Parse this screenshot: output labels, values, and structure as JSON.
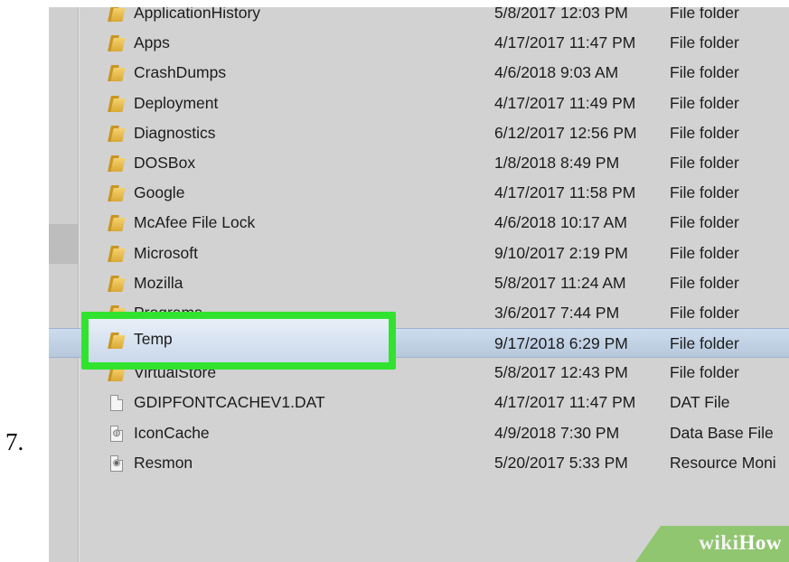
{
  "step_number": "7.",
  "files": [
    {
      "name": "ApplicationHistory",
      "date": "5/8/2017 12:03 PM",
      "type": "File folder",
      "icon": "folder-icon"
    },
    {
      "name": "Apps",
      "date": "4/17/2017 11:47 PM",
      "type": "File folder",
      "icon": "folder-icon"
    },
    {
      "name": "CrashDumps",
      "date": "4/6/2018 9:03 AM",
      "type": "File folder",
      "icon": "folder-icon"
    },
    {
      "name": "Deployment",
      "date": "4/17/2017 11:49 PM",
      "type": "File folder",
      "icon": "folder-icon"
    },
    {
      "name": "Diagnostics",
      "date": "6/12/2017 12:56 PM",
      "type": "File folder",
      "icon": "folder-icon"
    },
    {
      "name": "DOSBox",
      "date": "1/8/2018 8:49 PM",
      "type": "File folder",
      "icon": "folder-icon"
    },
    {
      "name": "Google",
      "date": "4/17/2017 11:58 PM",
      "type": "File folder",
      "icon": "folder-icon"
    },
    {
      "name": "McAfee File Lock",
      "date": "4/6/2018 10:17 AM",
      "type": "File folder",
      "icon": "folder-icon"
    },
    {
      "name": "Microsoft",
      "date": "9/10/2017 2:19 PM",
      "type": "File folder",
      "icon": "folder-icon"
    },
    {
      "name": "Mozilla",
      "date": "5/8/2017 11:24 AM",
      "type": "File folder",
      "icon": "folder-icon"
    },
    {
      "name": "Programs",
      "date": "3/6/2017 7:44 PM",
      "type": "File folder",
      "icon": "folder-icon"
    },
    {
      "name": "Temp",
      "date": "9/17/2018 6:29 PM",
      "type": "File folder",
      "icon": "folder-icon",
      "selected": true
    },
    {
      "name": "VirtualStore",
      "date": "5/8/2017 12:43 PM",
      "type": "File folder",
      "icon": "folder-icon"
    },
    {
      "name": "GDIPFONTCACHEV1.DAT",
      "date": "4/17/2017 11:47 PM",
      "type": "DAT File",
      "icon": "dat-file-icon"
    },
    {
      "name": "IconCache",
      "date": "4/9/2018 7:30 PM",
      "type": "Data Base File",
      "icon": "database-file-icon"
    },
    {
      "name": "Resmon",
      "date": "5/20/2017 5:33 PM",
      "type": "Resource Moni",
      "icon": "resource-monitor-icon"
    }
  ],
  "highlight": {
    "label": "Temp",
    "color": "#31e32f"
  },
  "watermark": {
    "lead": "wiki",
    "accent": "How"
  }
}
